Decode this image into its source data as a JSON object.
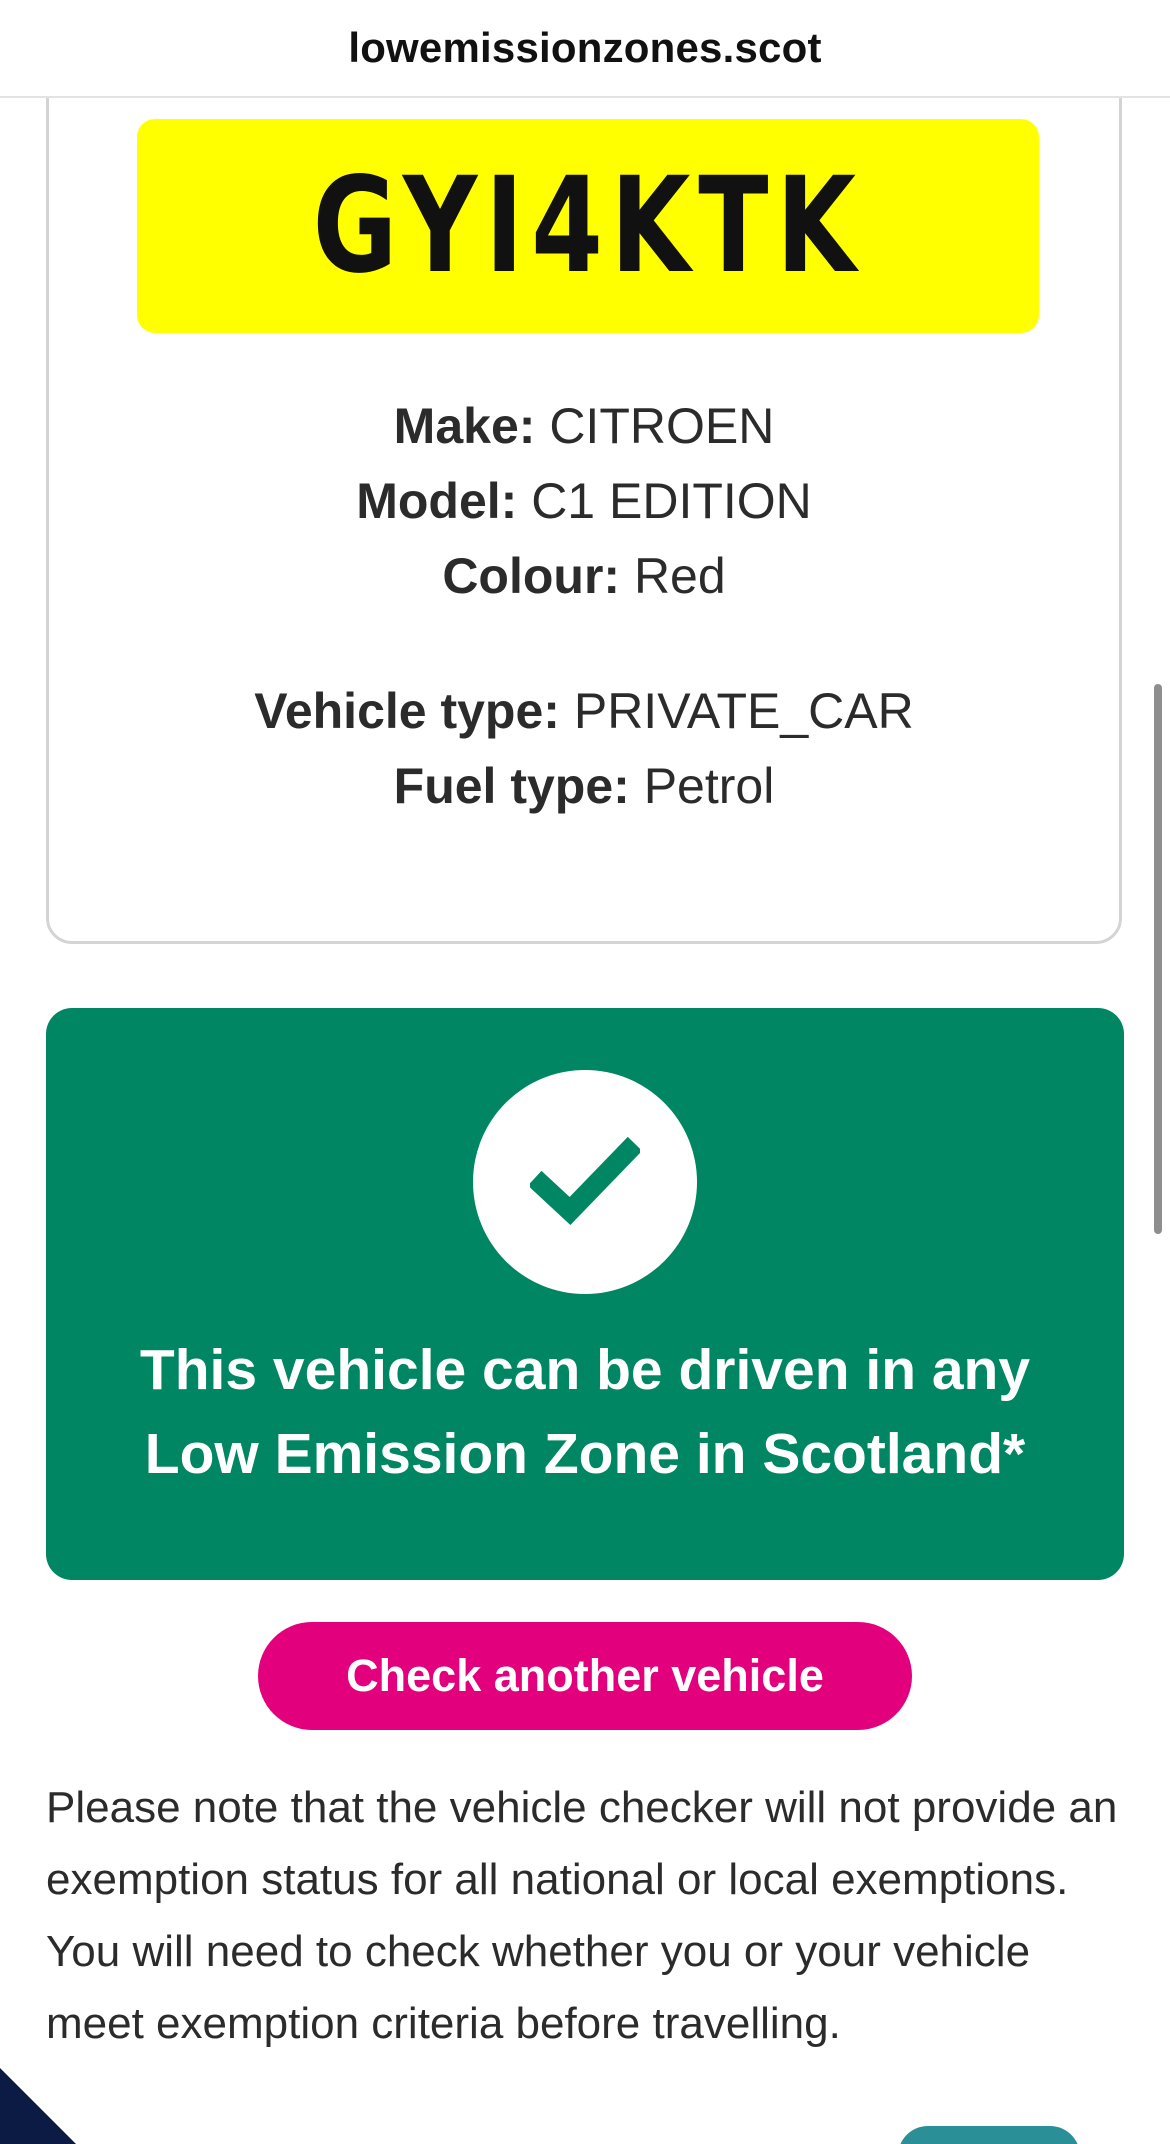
{
  "browser": {
    "url": "lowemissionzones.scot"
  },
  "vehicle": {
    "registration": "GYI4KTK",
    "make_label": "Make:",
    "make": "CITROEN",
    "model_label": "Model:",
    "model": "C1 EDITION",
    "colour_label": "Colour:",
    "colour": "Red",
    "vehicle_type_label": "Vehicle type:",
    "vehicle_type": "PRIVATE_CAR",
    "fuel_type_label": "Fuel type:",
    "fuel_type": "Petrol"
  },
  "result": {
    "icon": "checkmark-icon",
    "line1": "This vehicle can be driven in any",
    "line2": "Low Emission Zone in Scotland*"
  },
  "actions": {
    "check_another_label": "Check another vehicle"
  },
  "note": {
    "text": "Please note that the vehicle checker will not provide an exemption status for all national or local exemptions. You will need to check whether you or your vehicle meet exemption criteria before travelling."
  },
  "colors": {
    "plate_yellow": "#ffff00",
    "success_green": "#008662",
    "button_magenta": "#e3007d"
  }
}
